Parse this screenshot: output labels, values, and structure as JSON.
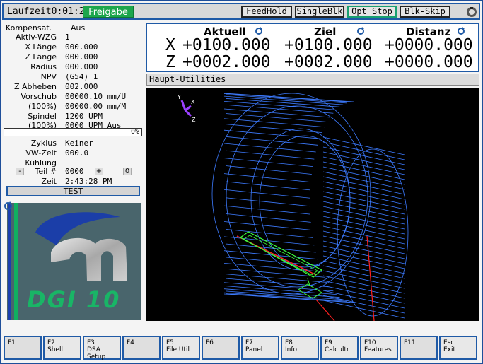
{
  "topbar": {
    "runtime_label": "Laufzeit",
    "runtime_value": "0:01:21",
    "status_badge": "Freigabe",
    "buttons": [
      "FeedHold",
      "SingleBlk",
      "Opt Stop",
      "Blk-Skip"
    ]
  },
  "left": {
    "kompensat_label": "Kompensat.",
    "kompensat_value": "Aus",
    "rows": [
      {
        "label": "Aktiv-WZG",
        "value": "1"
      },
      {
        "label": "X Länge",
        "value": "000.000"
      },
      {
        "label": "Z Länge",
        "value": "000.000"
      },
      {
        "label": "Radius",
        "value": "000.000"
      },
      {
        "label": "NPV",
        "value": "(G54) 1"
      },
      {
        "label": "Z Abheben",
        "value": "002.000"
      },
      {
        "label": "Vorschub",
        "value": "00000.10 mm/U"
      },
      {
        "label": "(100%)",
        "value": "00000.00 mm/M"
      },
      {
        "label": "Spindel",
        "value": "1200 UPM"
      },
      {
        "label": "(100%)",
        "value": "0000 UPM Aus"
      }
    ],
    "progress_text": "0%",
    "progress_value": 0,
    "rows2": [
      {
        "label": "Zyklus",
        "value": "Keiner"
      },
      {
        "label": "VW-Zeit",
        "value": "000.0"
      },
      {
        "label": "Kühlung",
        "value": ""
      }
    ],
    "teil_minus": "-",
    "teil_label": "Teil #",
    "teil_value": "0000",
    "teil_plus": "+",
    "teil_zero": "0",
    "zeit_label": "Zeit",
    "zeit_value": "2:43:28 PM",
    "test_button": "TEST",
    "logo_text": "DGI 10"
  },
  "dro": {
    "headers": [
      "Aktuell",
      "Ziel",
      "Distanz"
    ],
    "x_label": "X",
    "z_label": "Z",
    "x_values": [
      "+0100.000",
      "+0100.000",
      "+0000.000"
    ],
    "z_values": [
      "+0002.000",
      "+0002.000",
      "+0000.000"
    ]
  },
  "utilities": {
    "title": "Haupt-Utilities",
    "axis_y": "Y",
    "axis_x": "X",
    "axis_z": "Z"
  },
  "fkeys": [
    {
      "key": "F1",
      "label": ""
    },
    {
      "key": "F2",
      "label": "Shell"
    },
    {
      "key": "F3",
      "label": "DSA Setup"
    },
    {
      "key": "F4",
      "label": ""
    },
    {
      "key": "F5",
      "label": "File Util"
    },
    {
      "key": "F6",
      "label": ""
    },
    {
      "key": "F7",
      "label": "Panel"
    },
    {
      "key": "F8",
      "label": "Info"
    },
    {
      "key": "F9",
      "label": "Calcultr"
    },
    {
      "key": "F10",
      "label": "Features"
    },
    {
      "key": "F11",
      "label": ""
    },
    {
      "key": "Esc",
      "label": "Exit"
    }
  ],
  "colors": {
    "accent_blue": "#1f5aa6",
    "badge_green": "#1ca64c",
    "wireframe": "#3d7bff",
    "toolpath_red": "#ff2020",
    "tool_green": "#3cff3c"
  }
}
